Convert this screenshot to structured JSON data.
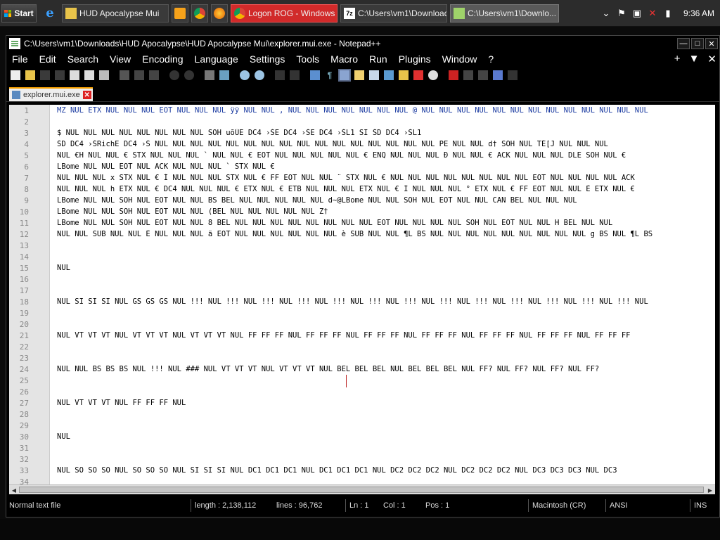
{
  "taskbar": {
    "start_label": "Start",
    "tasks": [
      {
        "label": "HUD Apocalypse Mui",
        "icon": "folder-icon"
      },
      {
        "label": "",
        "icon": "media-player-icon"
      },
      {
        "label": "",
        "icon": "chrome-icon"
      },
      {
        "label": "",
        "icon": "firefox-icon"
      },
      {
        "label": "Logon ROG - Windows ...",
        "icon": "chrome-icon",
        "color": "#d12a2a"
      },
      {
        "label": "C:\\Users\\vm1\\Download...",
        "icon": "7zip-icon"
      },
      {
        "label": "C:\\Users\\vm1\\Downlo...",
        "icon": "notepadpp-icon",
        "active": true
      }
    ],
    "clock": "9:36 AM"
  },
  "window": {
    "title": "C:\\Users\\vm1\\Downloads\\HUD Apocalypse\\HUD Apocalypse Mui\\explorer.mui.exe - Notepad++",
    "menu": [
      "File",
      "Edit",
      "Search",
      "View",
      "Encoding",
      "Language",
      "Settings",
      "Tools",
      "Macro",
      "Run",
      "Plugins",
      "Window",
      "?"
    ],
    "menu_right": [
      "+",
      "▼",
      "✕"
    ],
    "tab_label": "explorer.mui.exe"
  },
  "editor": {
    "lines": [
      {
        "n": "1",
        "text": "MZ NUL ETX NUL NUL NUL EOT NUL NUL NUL ÿÿ NUL NUL , NUL NUL NUL NUL NUL NUL NUL @ NUL NUL NUL NUL NUL NUL NUL NUL NUL NUL NUL NUL NUL"
      },
      {
        "n": "2",
        "text": ""
      },
      {
        "n": "3",
        "text": "$ NUL NUL NUL NUL NUL NUL NUL NUL SOH uõÜE DC4 ›ŠE DC4 ›ŠE DC4 ›ŠL1 SI ŠD DC4 ›ŠL1"
      },
      {
        "n": "4",
        "text": "ŠD DC4 ›ŠRichE DC4 ›Š NUL NUL NUL NUL NUL NUL NUL NUL NUL NUL NUL NUL NUL NUL NUL NUL PE NUL NUL d† SOH NUL TÉ[J NUL NUL NUL"
      },
      {
        "n": "5",
        "text": "NUL €H NUL NUL € STX NUL NUL NUL ` NUL NUL € EOT NUL NUL NUL NUL NUL € ENQ NUL NUL NUL Ð NUL NUL € ACK NUL NUL NUL DLE SOH NUL €"
      },
      {
        "n": "6",
        "text": "LBome NUL NUL EOT NUL ACK NUL NUL NUL ` STX NUL €"
      },
      {
        "n": "7",
        "text": "NUL NUL NUL x STX NUL € Í NUL NUL NUL STX NUL € FF EOT NUL NUL ¨ STX NUL € NUL NUL NUL NUL NUL NUL NUL NUL EOT NUL NUL NUL NUL ACK"
      },
      {
        "n": "8",
        "text": "NUL NUL NUL h ETX NUL € DC4 NUL NUL NUL € ETX NUL € ETB NUL NUL NUL ETX NUL € Í NUL NUL NUL ° ETX NUL € FF EOT NUL NUL È ETX NUL €"
      },
      {
        "n": "9",
        "text": "LBome NUL NUL SOH NUL  EOT NUL NUL BS BEL NUL NUL NUL NUL NUL d~@LBome NUL NUL SOH NUL  EOT NUL NUL CAN BEL NUL NUL NUL"
      },
      {
        "n": "10",
        "text": "LBome NUL NUL SOH NUL  EOT NUL NUL (BEL NUL NUL NUL NUL NUL Z†"
      },
      {
        "n": "11",
        "text": "LBome NUL NUL SOH NUL  EOT NUL NUL 8 BEL NUL NUL NUL NUL NUL NUL NUL NUL EOT NUL NUL NUL NUL SOH NUL  EOT NUL NUL H BEL NUL NUL"
      },
      {
        "n": "12",
        "text": "NUL NUL  SUB NUL NUL È NUL NUL NUL ä EOT NUL NUL NUL NUL NUL NUL è SUB NUL NUL ¶L BS NUL NUL NUL NUL NUL NUL NUL NUL NUL  g BS NUL ¶L BS"
      },
      {
        "n": "13",
        "text": ""
      },
      {
        "n": "14",
        "text": ""
      },
      {
        "n": "15",
        "text": "NUL"
      },
      {
        "n": "16",
        "text": ""
      },
      {
        "n": "17",
        "text": ""
      },
      {
        "n": "18",
        "text": "NUL SI SI SI NUL GS GS GS NUL !!! NUL !!! NUL !!! NUL !!! NUL !!! NUL !!! NUL !!! NUL !!! NUL !!! NUL !!! NUL !!! NUL !!! NUL !!! NUL"
      },
      {
        "n": "19",
        "text": ""
      },
      {
        "n": "20",
        "text": ""
      },
      {
        "n": "21",
        "text": "NUL VT VT VT NUL VT VT VT NUL VT VT VT NUL FF FF FF NUL FF FF FF NUL FF FF FF NUL FF FF FF NUL FF FF FF NUL FF FF FF NUL FF FF FF"
      },
      {
        "n": "22",
        "text": ""
      },
      {
        "n": "23",
        "text": ""
      },
      {
        "n": "24",
        "text": "NUL          NUL BS BS BS NUL !!! NUL ### NUL VT VT VT NUL VT VT VT NUL BEL BEL BEL NUL BEL BEL BEL NUL FF? NUL FF? NUL FF? NUL FF?"
      },
      {
        "n": "25",
        "text": ""
      },
      {
        "n": "26",
        "text": ""
      },
      {
        "n": "27",
        "text": "NUL VT VT VT NUL FF FF FF NUL"
      },
      {
        "n": "28",
        "text": ""
      },
      {
        "n": "29",
        "text": ""
      },
      {
        "n": "30",
        "text": "NUL"
      },
      {
        "n": "31",
        "text": ""
      },
      {
        "n": "32",
        "text": ""
      },
      {
        "n": "33",
        "text": "NUL SO SO SO NUL SO SO SO NUL SI SI SI NUL DC1 DC1 DC1 NUL DC1 DC1 DC1 NUL DC2 DC2 DC2 NUL DC2 DC2 DC2 NUL DC3 DC3 DC3 NUL DC3"
      },
      {
        "n": "34",
        "text": ""
      }
    ]
  },
  "statusbar": {
    "file_type": "Normal text file",
    "length": "length : 2,138,112",
    "lines": "lines : 96,762",
    "ln": "Ln : 1",
    "col": "Col : 1",
    "pos": "Pos : 1",
    "eol": "Macintosh (CR)",
    "encoding": "ANSI",
    "mode": "INS"
  }
}
